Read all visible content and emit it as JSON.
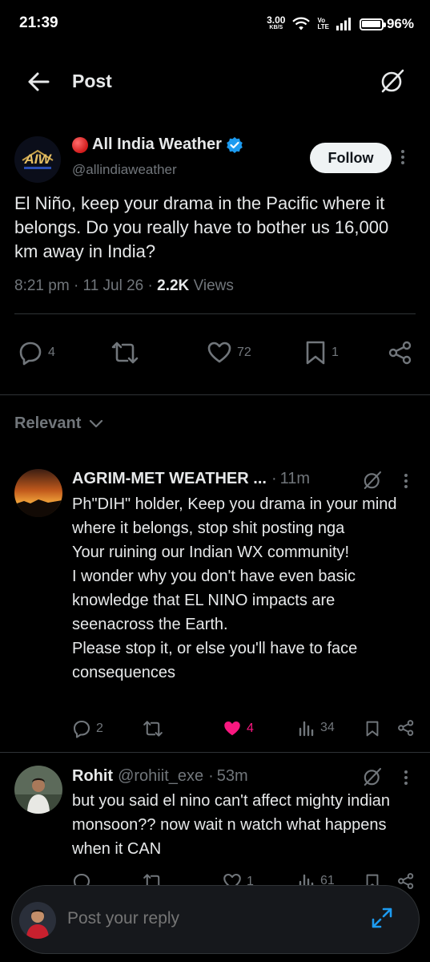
{
  "status_bar": {
    "time": "21:39",
    "speed_value": "3.00",
    "speed_unit": "KB/S",
    "volte_top": "Vo",
    "volte_bottom": "LTE",
    "battery": "96%",
    "battery_level": 0.96
  },
  "header": {
    "title": "Post",
    "back_icon": "arrow-left-icon",
    "grok_icon": "grok-icon"
  },
  "post": {
    "author_name": "All India Weather",
    "author_handle": "@allindiaweather",
    "avatar_text": "AIW",
    "follow_label": "Follow",
    "text": "El Niño, keep your drama in the Pacific where it belongs. Do you really have to bother us 16,000 km away in India?",
    "time": "8:21 pm",
    "date": "11 Jul 26",
    "views_count": "2.2K",
    "views_label": "Views",
    "replies": "4",
    "reposts": "",
    "likes": "72",
    "bookmarks": "1"
  },
  "sort": {
    "label": "Relevant"
  },
  "replies": [
    {
      "name": "AGRIM-MET WEATHER ...",
      "handle": "",
      "time": "11m",
      "lines": [
        "Ph\"DIH\" holder, Keep you drama in your mind where it belongs, stop shit posting nga",
        "Your ruining our Indian WX community!",
        "I wonder why you don't have even basic knowledge that EL NINO impacts are seenacross the Earth.",
        "Please stop it, or else you'll have to face consequences"
      ],
      "replies": "2",
      "reposts": "",
      "likes": "4",
      "views": "34"
    },
    {
      "name": "Rohit",
      "handle": "@rohiit_exe",
      "time": "53m",
      "lines": [
        "but you said el nino can't affect mighty indian monsoon?? now wait n watch what happens when it CAN"
      ],
      "replies": "",
      "reposts": "",
      "likes": "1",
      "views": "61"
    }
  ],
  "composer": {
    "placeholder": "Post your reply"
  },
  "colors": {
    "background": "#000000",
    "text": "#e7e9ea",
    "muted": "#71767b",
    "verified": "#1d9bf0",
    "like_pink": "#f91880",
    "divider": "#2f3336"
  }
}
